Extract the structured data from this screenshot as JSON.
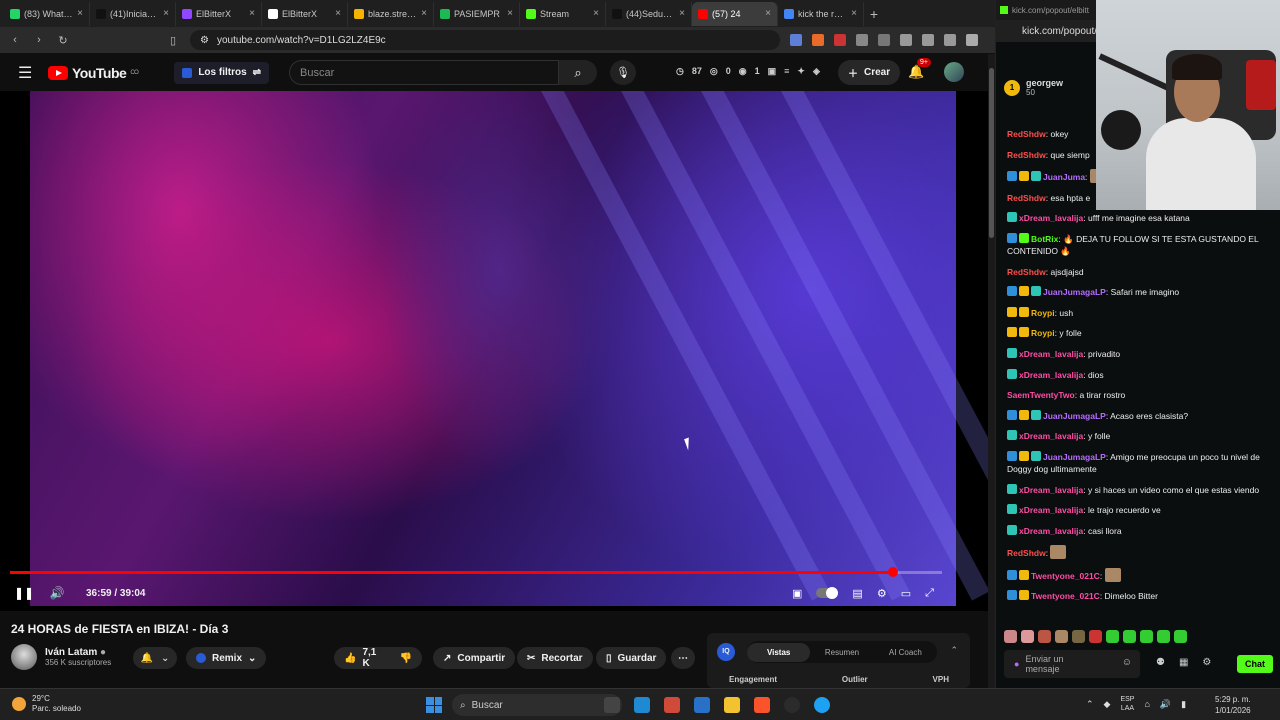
{
  "browser": {
    "tabs": [
      {
        "label": "(83) WhatsApp",
        "color": "#25d366"
      },
      {
        "label": "(41)Iniciando n",
        "color": "#111111"
      },
      {
        "label": "ElBitterX",
        "color": "#9146ff"
      },
      {
        "label": "ElBitterX",
        "color": "#ffffff"
      },
      {
        "label": "blaze.stream/s",
        "color": "#f5b400"
      },
      {
        "label": "PASIEMPR",
        "color": "#1db954"
      },
      {
        "label": "Stream",
        "color": "#53fc18"
      },
      {
        "label": "(44)SeduceLaV",
        "color": "#111111"
      },
      {
        "label": "(57) 24",
        "color": "#ff0000"
      },
      {
        "label": "kick the rules",
        "color": "#4285f4"
      }
    ],
    "url": "youtube.com/watch?v=D1LG2LZ4E9c"
  },
  "youtube": {
    "logo_text": "YouTube",
    "logo_region": "CO",
    "filters_label": "Los filtros",
    "search_placeholder": "Buscar",
    "stats": {
      "a": "87",
      "b": "0",
      "c": "1"
    },
    "create_label": "Crear",
    "notif_count": "9+",
    "player": {
      "time": "36:59 / 39:04",
      "progress": 0.947
    },
    "video_title": "24 HORAS de FIESTA en IBIZA! - Día 3",
    "channel_name": "Iván Latam",
    "subscribers": "356 K suscriptores",
    "remix_label": "Remix",
    "likes": "7,1 K",
    "share_label": "Compartir",
    "clip_label": "Recortar",
    "save_label": "Guardar",
    "panel": {
      "tabs": [
        "Vistas",
        "Resumen",
        "AI Coach"
      ],
      "columns": [
        "Engagement",
        "Outlier",
        "VPH"
      ]
    }
  },
  "kick": {
    "tab_label": "kick.com/popout/elbitt",
    "url": "kick.com/popout/",
    "gift": {
      "user": "georgew",
      "amount": "50"
    },
    "messages": [
      {
        "user": "RedShdw",
        "color": "#ff4d4d",
        "text": "okey",
        "badges": []
      },
      {
        "user": "RedShdw",
        "color": "#ff4d4d",
        "text": "que siemp",
        "badges": []
      },
      {
        "user": "JuanJuma",
        "color": "#b56bff",
        "text": "",
        "badges": [
          "#2f8fd8",
          "#f0b90b",
          "#2ec4b6"
        ]
      },
      {
        "user": "RedShdw",
        "color": "#ff4d4d",
        "text": "esa hpta e",
        "badges": []
      },
      {
        "user": "xDream_lavalija",
        "color": "#ff4da6",
        "text": "ufff me imagine esa katana",
        "badges": [
          "#2ec4b6"
        ]
      },
      {
        "user": "BotRix",
        "color": "#53fc18",
        "text": "🔥 DEJA TU FOLLOW SI TE ESTA GUSTANDO EL CONTENIDO 🔥",
        "badges": [
          "#2f8fd8",
          "#53fc18"
        ]
      },
      {
        "user": "RedShdw",
        "color": "#ff4d4d",
        "text": "ajsdjajsd",
        "badges": []
      },
      {
        "user": "JuanJumagaLP",
        "color": "#b56bff",
        "text": "Safari me imagino",
        "badges": [
          "#2f8fd8",
          "#f0b90b",
          "#2ec4b6"
        ]
      },
      {
        "user": "Roypi",
        "color": "#f0b90b",
        "text": "ush",
        "badges": [
          "#f0b90b",
          "#f0b90b"
        ]
      },
      {
        "user": "Roypi",
        "color": "#f0b90b",
        "text": "y folle",
        "badges": [
          "#f0b90b",
          "#f0b90b"
        ]
      },
      {
        "user": "xDream_lavalija",
        "color": "#ff4da6",
        "text": "privadito",
        "badges": [
          "#2ec4b6"
        ]
      },
      {
        "user": "xDream_lavalija",
        "color": "#ff4da6",
        "text": "dios",
        "badges": [
          "#2ec4b6"
        ]
      },
      {
        "user": "SaemTwentyTwo",
        "color": "#ff4da6",
        "text": "a tirar rostro",
        "badges": []
      },
      {
        "user": "JuanJumagaLP",
        "color": "#b56bff",
        "text": "Acaso eres clasista?",
        "badges": [
          "#2f8fd8",
          "#f0b90b",
          "#2ec4b6"
        ]
      },
      {
        "user": "xDream_lavalija",
        "color": "#ff4da6",
        "text": "y folle",
        "badges": [
          "#2ec4b6"
        ]
      },
      {
        "user": "JuanJumagaLP",
        "color": "#b56bff",
        "text": "Amigo me preocupa un poco tu nivel de Doggy dog ultimamente",
        "badges": [
          "#2f8fd8",
          "#f0b90b",
          "#2ec4b6"
        ]
      },
      {
        "user": "xDream_lavalija",
        "color": "#ff4da6",
        "text": "y si haces un video como el que estas viendo",
        "badges": [
          "#2ec4b6"
        ]
      },
      {
        "user": "xDream_lavalija",
        "color": "#ff4da6",
        "text": "le trajo recuerdo ve",
        "badges": [
          "#2ec4b6"
        ]
      },
      {
        "user": "xDream_lavalija",
        "color": "#ff4da6",
        "text": "casi llora",
        "badges": [
          "#2ec4b6"
        ]
      },
      {
        "user": "RedShdw",
        "color": "#ff4d4d",
        "text": "",
        "badges": []
      },
      {
        "user": "Twentyone_021C",
        "color": "#ff4da6",
        "text": "",
        "badges": [
          "#2f8fd8",
          "#f0b90b"
        ]
      },
      {
        "user": "Twentyone_021C",
        "color": "#ff4da6",
        "text": "Dimeloo Bitter",
        "badges": [
          "#2f8fd8",
          "#f0b90b"
        ]
      }
    ],
    "input_placeholder": "Enviar un mensaje",
    "chat_button": "Chat"
  },
  "taskbar": {
    "temp": "29°C",
    "weather": "Parc. soleado",
    "search": "Buscar",
    "lang1": "ESP",
    "lang2": "LAA",
    "time": "5:29 p. m.",
    "date": "1/01/2026"
  }
}
